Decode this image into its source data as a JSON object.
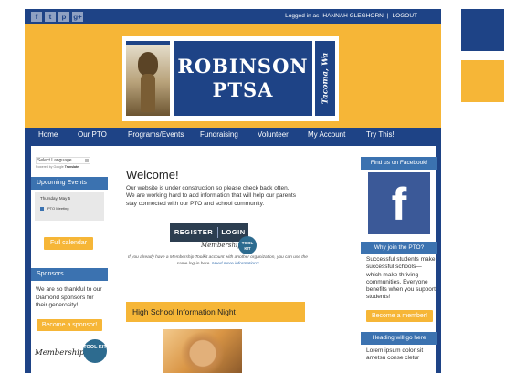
{
  "social": [
    "f",
    "t",
    "p",
    "g+"
  ],
  "login": {
    "label": "Logged in as",
    "user": "HANNAH GLEGHORN",
    "sep": "|",
    "logout": "LOGOUT"
  },
  "logo": {
    "line1": "ROBINSON",
    "line2": "PTSA",
    "side": "Tacoma, Wa"
  },
  "nav": [
    "Home",
    "Our PTO",
    "Programs/Events",
    "Fundraising",
    "Volunteer",
    "My Account",
    "Try This!"
  ],
  "left": {
    "language_select": "Select Language",
    "powered_by": "Powered by",
    "google": "Google",
    "translate": "Translate",
    "events_title": "Upcoming Events",
    "cal_day": "Thursday, May 5",
    "cal_event": "PTO Meeting",
    "full_calendar": "Full calendar",
    "sponsors_title": "Sponsors",
    "sponsors_text": "We are so thankful to our Diamond sponsors for their generosity!",
    "become_sponsor": "Become a sponsor!",
    "mkit_script": "Membership",
    "mkit_badge": "TOOL KIT"
  },
  "main": {
    "welcome": "Welcome!",
    "intro": "Our website is under construction so please check back often. We are working hard to add information that will help our parents stay connected with our PTO and school community.",
    "register": "REGISTER",
    "login": "LOGIN",
    "reg_script": "Membership",
    "reg_badge": "TOOL KIT",
    "already": "If you already have a Membership Toolkit account with another organization, you can use the same log-in here.",
    "more_info": "Need more information?",
    "hs_title": "High School Information Night"
  },
  "right": {
    "facebook_title": "Find us on Facebook!",
    "fb_icon": "f",
    "why_title": "Why join the PTO?",
    "why_text": "Successful students make successful schools— which make thriving communities. Everyone benefits when you support students!",
    "become_member": "Become a member!",
    "heading_title": "Heading will go here",
    "lorem": "Lorem ipsum dolor sit ametsu conse cletur"
  },
  "palette": {
    "navy": "#1e4386",
    "gold": "#f6b637",
    "section_blue": "#3b72b0",
    "facebook": "#3b5998"
  }
}
